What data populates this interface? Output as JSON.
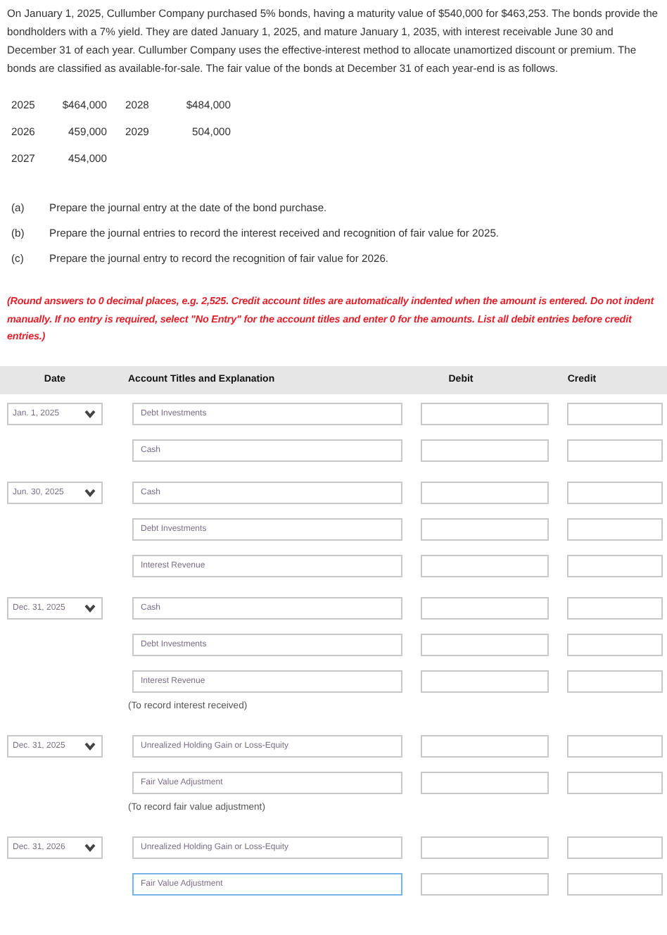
{
  "problem": {
    "text": "On January 1, 2025, Cullumber Company purchased 5% bonds, having a maturity value of $540,000 for $463,253. The bonds provide the bondholders with a 7% yield. They are dated January 1, 2025, and mature January 1, 2035, with interest receivable June 30 and December 31 of each year. Cullumber Company uses the effective-interest method to allocate unamortized discount or premium. The bonds are classified as available-for-sale. The fair value of the bonds at December 31 of each year-end is as follows.",
    "fair_values": [
      [
        "2025",
        "$464,000",
        "2028",
        "$484,000"
      ],
      [
        "2026",
        "459,000",
        "2029",
        "504,000"
      ],
      [
        "2027",
        "454,000"
      ]
    ],
    "parts": [
      {
        "label": "(a)",
        "text": "Prepare the journal entry at the date of the bond purchase."
      },
      {
        "label": "(b)",
        "text": "Prepare the journal entries to record the interest received and recognition of fair value for 2025."
      },
      {
        "label": "(c)",
        "text": "Prepare the journal entry to record the recognition of fair value for 2026."
      }
    ],
    "instructions": "(Round answers to 0 decimal places, e.g. 2,525. Credit account titles are automatically indented when the amount is entered. Do not indent manually. If no entry is required, select \"No Entry\" for the account titles and enter 0 for the amounts. List all debit entries before credit entries.)"
  },
  "journal": {
    "columns": [
      "Date",
      "Account Titles and Explanation",
      "Debit",
      "Credit"
    ],
    "entries": [
      {
        "date": "Jan. 1, 2025",
        "lines": [
          {
            "account": "Debt Investments",
            "focused": false
          },
          {
            "account": "Cash",
            "focused": false
          }
        ]
      },
      {
        "date": "Jun. 30, 2025",
        "lines": [
          {
            "account": "Cash",
            "focused": false
          },
          {
            "account": "Debt Investments",
            "focused": false
          },
          {
            "account": "Interest Revenue",
            "focused": false
          }
        ]
      },
      {
        "date": "Dec. 31, 2025",
        "lines": [
          {
            "account": "Cash",
            "focused": false
          },
          {
            "account": "Debt Investments",
            "focused": false
          },
          {
            "account": "Interest Revenue",
            "focused": false
          }
        ],
        "memo": "(To record interest received)"
      },
      {
        "date": "Dec. 31, 2025",
        "lines": [
          {
            "account": "Unrealized Holding Gain or Loss-Equity",
            "focused": false
          },
          {
            "account": "Fair Value Adjustment",
            "focused": false
          }
        ],
        "memo": "(To record fair value adjustment)"
      },
      {
        "date": "Dec. 31, 2026",
        "lines": [
          {
            "account": "Unrealized Holding Gain or Loss-Equity",
            "focused": false
          },
          {
            "account": "Fair Value Adjustment",
            "focused": true
          }
        ]
      }
    ]
  }
}
